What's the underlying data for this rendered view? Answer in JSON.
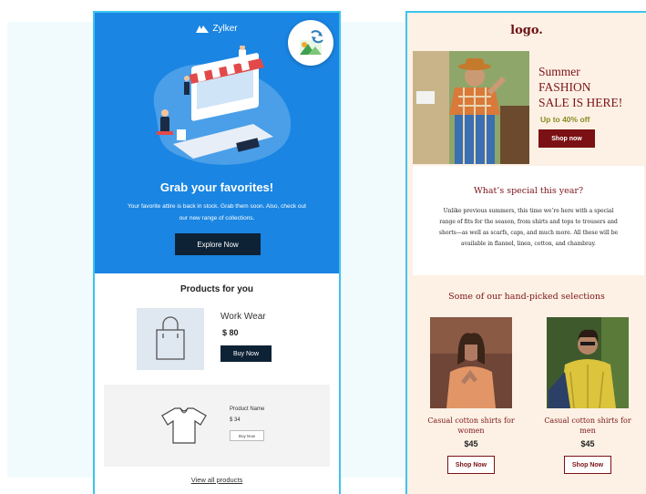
{
  "left_email": {
    "brand": "Zylker",
    "refresh_icon": "image-refresh-icon",
    "hero_title": "Grab your favorites!",
    "hero_text": "Your favorite attire is back in stock. Grab them soon. Also, check out our new range of collections.",
    "explore_label": "Explore Now",
    "products_title": "Products for you",
    "product1": {
      "name": "Work Wear",
      "price": "$ 80",
      "button": "Buy Now",
      "icon": "shopping-bag-icon"
    },
    "product2": {
      "name": "Product Name",
      "price": "$ 34",
      "button": "Buy Now",
      "icon": "tshirt-icon"
    },
    "view_all": "View all products",
    "colors": {
      "hero_bg": "#1a85e2",
      "button": "#0e2235",
      "border": "#3cc3ee"
    }
  },
  "right_email": {
    "logo": "logo.",
    "summer_title": [
      "Summer",
      "FASHION",
      "SALE IS HERE!"
    ],
    "discount": "Up to 40% off",
    "shop_now": "Shop now",
    "special_title": "What’s special this year?",
    "special_body": "Unlike previous summers, this time we’re here with a special range of fits for the season, from shirts and tops to trousers and shorts—as well as scarfs, caps, and much more. All these will be available in flannel, linen, cotton, and chambray.",
    "picks_title": "Some of our hand-picked selections",
    "picks": [
      {
        "name": "Casual cotton shirts for women",
        "price": "$45",
        "button": "Shop Now"
      },
      {
        "name": "Casual cotton shirts for men",
        "price": "$45",
        "button": "Shop Now"
      }
    ],
    "colors": {
      "accent": "#7b1418",
      "bg": "#fdf1e5",
      "discount": "#8a8a22"
    }
  }
}
